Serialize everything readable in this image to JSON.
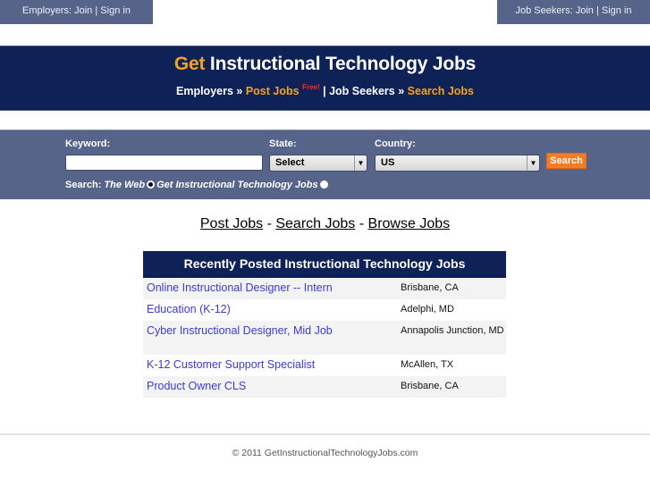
{
  "topbar": {
    "employers": {
      "prefix": "Employers: ",
      "join": "Join",
      "sep": " | ",
      "signin": "Sign in"
    },
    "jobseekers": {
      "prefix": "Job Seekers: ",
      "join": "Join",
      "sep": " | ",
      "signin": "Sign in"
    }
  },
  "header": {
    "title_get": "Get",
    "title_rest": " Instructional Technology Jobs",
    "subnav": {
      "employers": "Employers",
      "raquo": " » ",
      "post_jobs": "Post Jobs",
      "free": "Free!",
      "pipe": " | ",
      "job_seekers": "Job Seekers",
      "search_jobs": "Search Jobs"
    }
  },
  "search": {
    "keyword_label": "Keyword:",
    "keyword_value": "",
    "state_label": "State:",
    "state_value": "Select",
    "country_label": "Country:",
    "country_value": "US",
    "button_label": "Search",
    "scope_label": "Search:",
    "scope_options": [
      {
        "label": "The Web",
        "checked": true
      },
      {
        "label": "Get Instructional Technology Jobs",
        "checked": false
      }
    ],
    "arrow_glyph": "▼"
  },
  "links": {
    "post_jobs": "Post Jobs",
    "search_jobs": "Search Jobs",
    "browse_jobs": "Browse Jobs",
    "sep": " - "
  },
  "jobs": {
    "heading": "Recently Posted Instructional Technology Jobs",
    "rows": [
      {
        "title": "Online Instructional Designer -- Intern",
        "location": "Brisbane, CA"
      },
      {
        "title": "Education (K-12)",
        "location": "Adelphi, MD"
      },
      {
        "title": "Cyber Instructional Designer, Mid Job",
        "location": "Annapolis Junction, MD"
      },
      {
        "title": "K-12 Customer Support Specialist",
        "location": "McAllen, TX"
      },
      {
        "title": "Product Owner CLS",
        "location": "Brisbane, CA"
      }
    ]
  },
  "footer": {
    "copyright": "© 2011 GetInstructionalTechnologyJobs.com"
  },
  "colors": {
    "navy": "#0f2257",
    "slate": "#566489",
    "orange": "#f7a21b",
    "button_orange": "#f47b20",
    "link_blue": "#3b3bcf",
    "free_red": "#ff2a2a"
  }
}
